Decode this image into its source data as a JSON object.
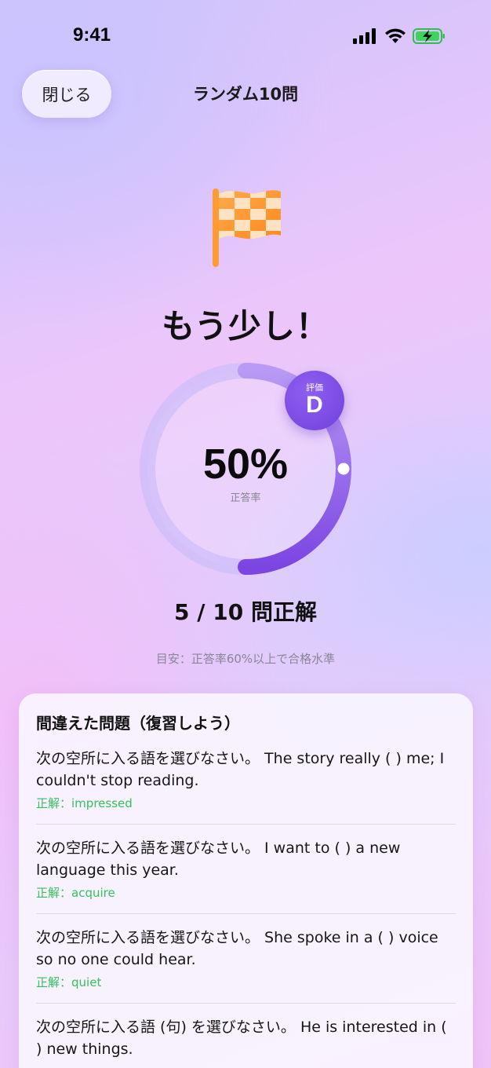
{
  "status_bar": {
    "time": "9:41"
  },
  "nav": {
    "close_label": "閉じる",
    "title": "ランダム10問"
  },
  "result": {
    "headline": "もう少し！",
    "percent": "50%",
    "percent_label": "正答率",
    "grade_label": "評価",
    "grade": "D",
    "score": "5 / 10 問正解",
    "guide": "目安：正答率60%以上で合格水準",
    "progress": 0.5
  },
  "review": {
    "title": "間違えた問題（復習しよう）",
    "answer_prefix": "正解：",
    "items": [
      {
        "question": "次の空所に入る語を選びなさい。 The story really (   ) me; I couldn't stop reading.",
        "answer": "impressed"
      },
      {
        "question": "次の空所に入る語を選びなさい。 I want to (   ) a new language this year.",
        "answer": "acquire"
      },
      {
        "question": "次の空所に入る語を選びなさい。 She spoke in a (   ) voice so no one could hear.",
        "answer": "quiet"
      },
      {
        "question": "次の空所に入る語 (句) を選びなさい。 He is interested in (   ) new things.",
        "answer": ""
      }
    ]
  },
  "colors": {
    "accent": "#7a48e3",
    "correct": "#34c15a",
    "flag_orange": "#ff9a2e"
  }
}
